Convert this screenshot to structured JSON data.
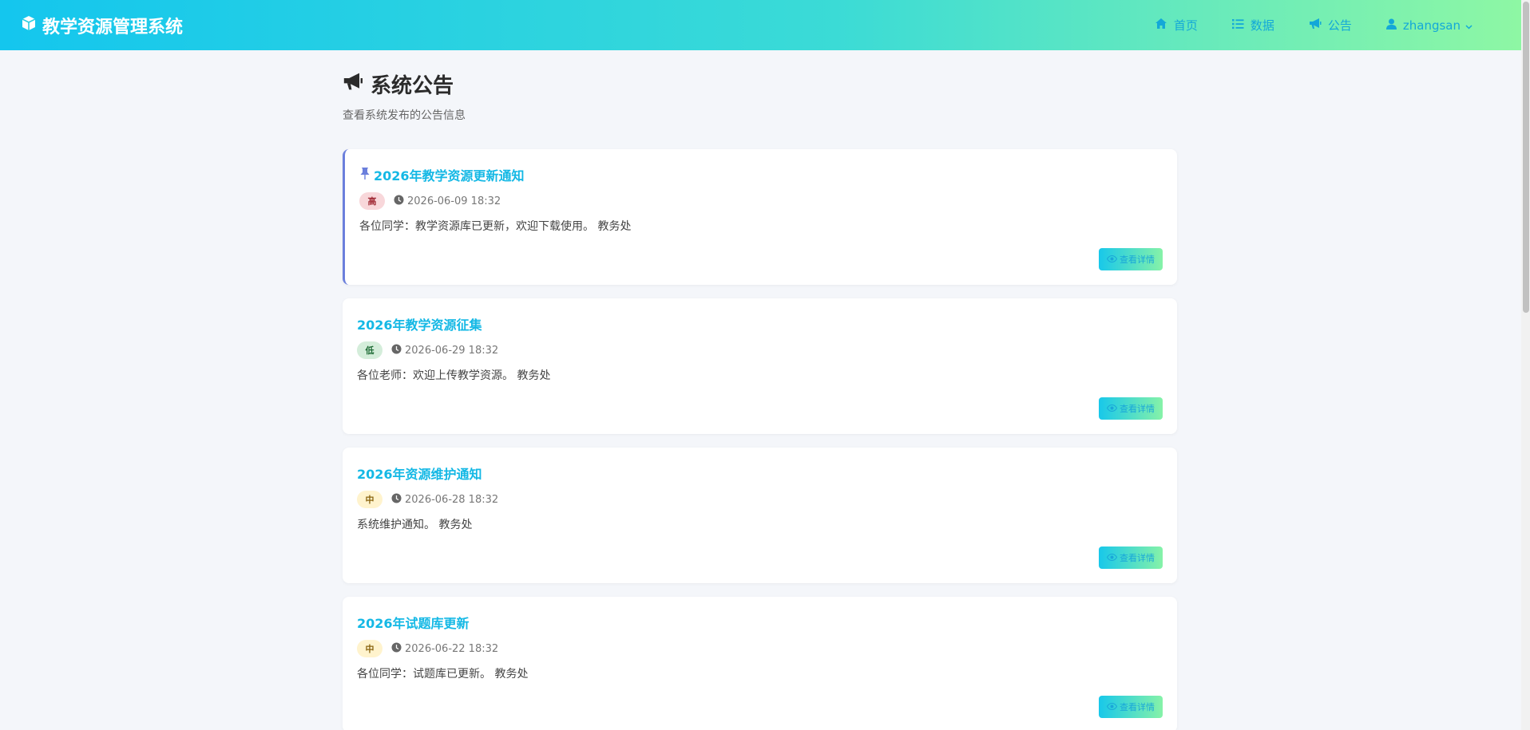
{
  "app": {
    "title": "教学资源管理系统"
  },
  "nav": {
    "home": "首页",
    "data": "数据",
    "notice": "公告",
    "user": "zhangsan"
  },
  "page": {
    "title": "系统公告",
    "subtitle": "查看系统发布的公告信息"
  },
  "announcements": [
    {
      "title": "2026年教学资源更新通知",
      "priority": "高",
      "time": "2026-06-09 18:32",
      "content": "各位同学：教学资源库已更新，欢迎下载使用。 教务处",
      "pinned": true,
      "button": "查看详情"
    },
    {
      "title": "2026年教学资源征集",
      "priority": "低",
      "time": "2026-06-29 18:32",
      "content": "各位老师：欢迎上传教学资源。 教务处",
      "pinned": false,
      "button": "查看详情"
    },
    {
      "title": "2026年资源维护通知",
      "priority": "中",
      "time": "2026-06-28 18:32",
      "content": "系统维护通知。 教务处",
      "pinned": false,
      "button": "查看详情"
    },
    {
      "title": "2026年试题库更新",
      "priority": "中",
      "time": "2026-06-22 18:32",
      "content": "各位同学：试题库已更新。 教务处",
      "pinned": false,
      "button": "查看详情"
    }
  ],
  "colors": {
    "accent": "#14b8e5",
    "gradient_start": "#14c6ee",
    "gradient_end": "#8ef7a4",
    "pin": "#6b7fdc"
  },
  "icons": {
    "brand": "cube-icon",
    "home": "home-icon",
    "data": "list-icon",
    "notice": "bullhorn-icon",
    "user": "user-icon",
    "dropdown": "chevron-down-icon",
    "pin": "pin-icon",
    "time": "clock-icon",
    "detail": "eye-icon"
  }
}
